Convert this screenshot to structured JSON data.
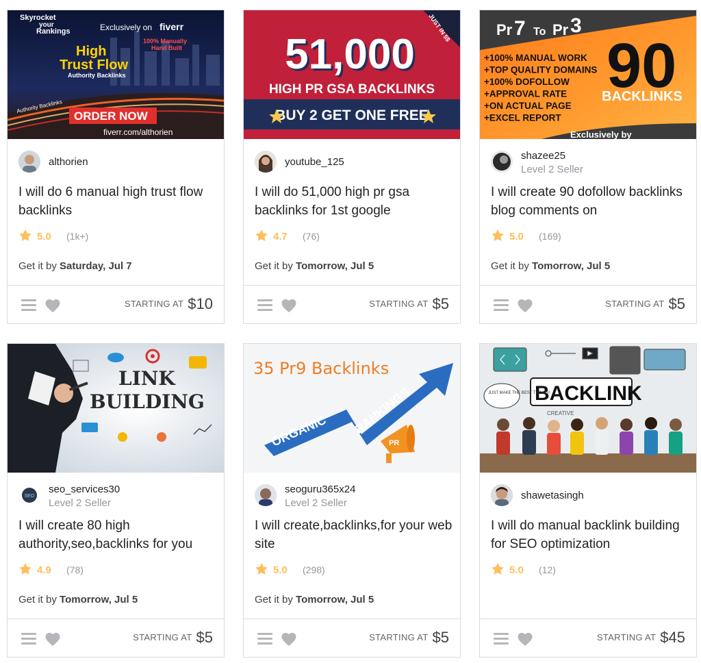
{
  "labels": {
    "get_it_by": "Get it by",
    "starting_at": "STARTING AT"
  },
  "colors": {
    "star": "#ffbe5b",
    "border": "#dadbdd",
    "muted": "#95979d"
  },
  "gigs": [
    {
      "image_text": {
        "line1": "Skyrocket",
        "line2": "your",
        "line3": "Rankings",
        "brand_prefix": "Exclusively on",
        "brand": "fiverr",
        "headline1": "High",
        "headline2": "Trust Flow",
        "sub": "Authority Backlinks",
        "badge1": "100% Manually",
        "badge2": "Hand Built",
        "road": "Authority Backlinks",
        "cta": "ORDER NOW",
        "url": "fiverr.com/althorien"
      },
      "seller": "althorien",
      "level": "",
      "title": "I will do 6 manual high trust flow backlinks",
      "rating": "5.0",
      "count": "(1k+)",
      "delivery": "Saturday, Jul 7",
      "price": "$10"
    },
    {
      "image_text": {
        "big": "51,000",
        "mid": "HIGH PR GSA BACKLINKS",
        "offer": "BUY 2 GET ONE FREE",
        "corner": "JUST IN 5$"
      },
      "seller": "youtube_125",
      "level": "",
      "title": "I will do 51,000 high pr gsa backlinks for 1st google",
      "rating": "4.7",
      "count": "(76)",
      "delivery": "Tomorrow, Jul 5",
      "price": "$5"
    },
    {
      "image_text": {
        "top_a": "Pr",
        "top_b": "7",
        "top_c": "To",
        "top_d": "Pr",
        "top_e": "3",
        "big": "90",
        "big_sub": "BACKLINKS",
        "list": [
          "+100% MANUAL WORK",
          "+TOP QUALITY DOMAINS",
          "+100% DOFOLLOW",
          "+APPROVAL RATE",
          "+ON ACTUAL PAGE",
          "+EXCEL REPORT"
        ],
        "footer": "Exclusively by"
      },
      "seller": "shazee25",
      "level": "Level 2 Seller",
      "title": "I will create 90 dofollow backlinks blog comments on",
      "rating": "5.0",
      "count": "(169)",
      "delivery": "Tomorrow, Jul 5",
      "price": "$5"
    },
    {
      "image_text": {
        "line1": "LINK",
        "line2": "BUILDING"
      },
      "seller": "seo_services30",
      "level": "Level 2 Seller",
      "title": "I will create 80 high authority,seo,backlinks for you",
      "rating": "4.9",
      "count": "(78)",
      "delivery": "Tomorrow, Jul 5",
      "price": "$5"
    },
    {
      "image_text": {
        "headline": "35 Pr9 Backlinks",
        "arrow1": "ORGANIC",
        "arrow2": "RANKINGS",
        "megaphone": "PR"
      },
      "seller": "seoguru365x24",
      "level": "Level 2 Seller",
      "title": "I will create,backlinks,for your web site",
      "rating": "5.0",
      "count": "(298)",
      "delivery": "Tomorrow, Jul 5",
      "price": "$5"
    },
    {
      "image_text": {
        "headline": "BACKLINK",
        "bubble": "JUST MAKE THE BEST THINGS!",
        "creative": "CREATIVE"
      },
      "seller": "shawetasingh",
      "level": "Level 2 Seller",
      "title": "I will do manual backlink building for SEO optimization",
      "rating": "5.0",
      "count": "(12)",
      "delivery": "",
      "price": "$45"
    }
  ]
}
